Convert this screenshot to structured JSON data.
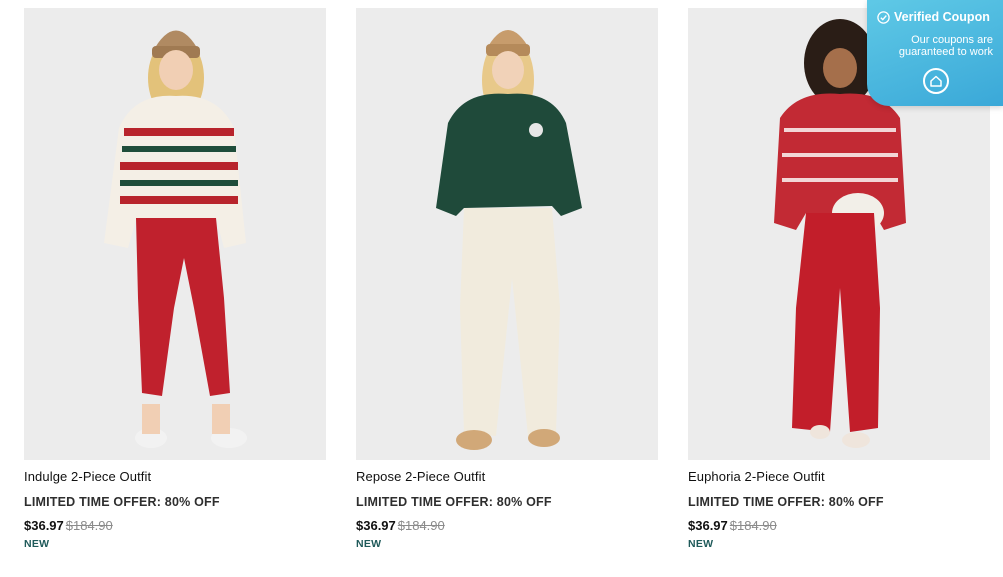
{
  "products": [
    {
      "name": "Indulge 2-Piece Outfit",
      "offer": "LIMITED TIME OFFER: 80% OFF",
      "price_now": "$36.97",
      "price_old": "$184.90",
      "badge": "NEW",
      "image_alt": "model in fair isle hoodie and red leggings"
    },
    {
      "name": "Repose 2-Piece Outfit",
      "offer": "LIMITED TIME OFFER: 80% OFF",
      "price_now": "$36.97",
      "price_old": "$184.90",
      "badge": "NEW",
      "image_alt": "model in green hoodie and cream pants"
    },
    {
      "name": "Euphoria 2-Piece Outfit",
      "offer": "LIMITED TIME OFFER: 80% OFF",
      "price_now": "$36.97",
      "price_old": "$184.90",
      "badge": "NEW",
      "image_alt": "model in red fair isle sweater and red pants"
    }
  ],
  "coupon": {
    "title": "Verified Coupon",
    "subtitle": "Our coupons are guaranteed to work",
    "icon": "check-circle-icon",
    "logo_icon": "house-logo-icon",
    "color": "#3aa8d8"
  },
  "colors": {
    "background": "#ffffff",
    "photo_bg": "#ebebeb",
    "badge": "#1f5a5a",
    "old_price": "#8b8b8b"
  }
}
